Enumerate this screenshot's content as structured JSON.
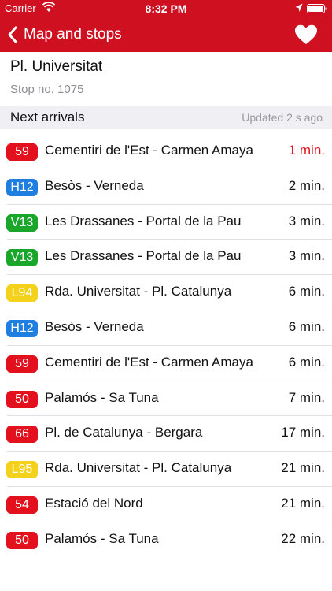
{
  "status_bar": {
    "carrier": "Carrier",
    "time": "8:32 PM"
  },
  "nav": {
    "back_label": "Map and stops",
    "back_icon": "chevron-left-icon",
    "favorite_icon": "heart-icon"
  },
  "stop": {
    "name": "Pl. Universitat",
    "number": "Stop no. 1075"
  },
  "arrivals": {
    "title": "Next arrivals",
    "updated": "Updated 2 s ago",
    "items": [
      {
        "line": "59",
        "color": "#e3101e",
        "destination": "Cementiri de l'Est - Carmen Amaya",
        "time": "1 min.",
        "time_color": "#e0101e"
      },
      {
        "line": "H12",
        "color": "#1e7fe0",
        "destination": "Besòs - Verneda",
        "time": "2 min."
      },
      {
        "line": "V13",
        "color": "#1aa52b",
        "destination": "Les Drassanes - Portal de la Pau",
        "time": "3 min."
      },
      {
        "line": "V13",
        "color": "#1aa52b",
        "destination": "Les Drassanes - Portal de la Pau",
        "time": "3 min."
      },
      {
        "line": "L94",
        "color": "#f4d21c",
        "destination": "Rda. Universitat - Pl. Catalunya",
        "time": "6 min."
      },
      {
        "line": "H12",
        "color": "#1e7fe0",
        "destination": "Besòs - Verneda",
        "time": "6 min."
      },
      {
        "line": "59",
        "color": "#e3101e",
        "destination": "Cementiri de l'Est - Carmen Amaya",
        "time": "6 min."
      },
      {
        "line": "50",
        "color": "#e3101e",
        "destination": "Palamós - Sa Tuna",
        "time": "7 min."
      },
      {
        "line": "66",
        "color": "#e3101e",
        "destination": "Pl. de Catalunya - Bergara",
        "time": "17 min."
      },
      {
        "line": "L95",
        "color": "#f4d21c",
        "destination": "Rda. Universitat - Pl. Catalunya",
        "time": "21 min."
      },
      {
        "line": "54",
        "color": "#e3101e",
        "destination": "Estació del Nord",
        "time": "21 min."
      },
      {
        "line": "50",
        "color": "#e3101e",
        "destination": "Palamós - Sa Tuna",
        "time": "22 min."
      }
    ]
  }
}
